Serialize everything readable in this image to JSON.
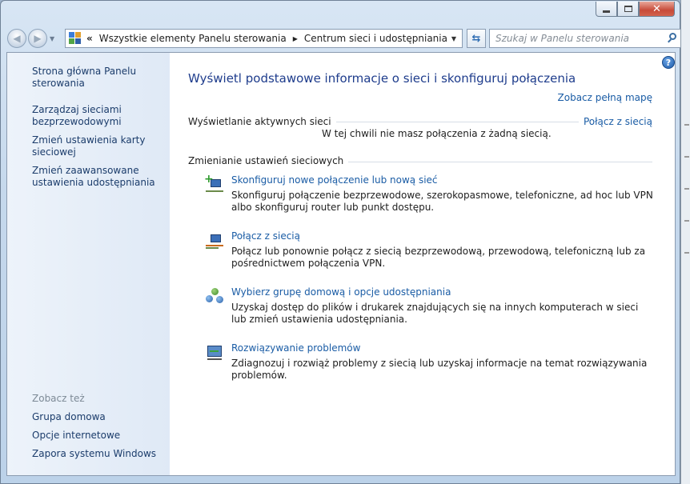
{
  "window": {
    "caption_minimize": "",
    "caption_maximize": "",
    "caption_close": "✕"
  },
  "nav": {
    "chevron": "«",
    "breadcrumbs": [
      "Wszystkie elementy Panelu sterowania",
      "Centrum sieci i udostępniania"
    ],
    "search_placeholder": "Szukaj w Panelu sterowania"
  },
  "sidebar": {
    "links": [
      "Strona główna Panelu sterowania",
      "Zarządzaj sieciami bezprzewodowymi",
      "Zmień ustawienia karty sieciowej",
      "Zmień zaawansowane ustawienia udostępniania"
    ],
    "see_also_heading": "Zobacz też",
    "see_also": [
      "Grupa domowa",
      "Opcje internetowe",
      "Zapora systemu Windows"
    ]
  },
  "main": {
    "title": "Wyświetl podstawowe informacje o sieci i skonfiguruj połączenia",
    "full_map_link": "Zobacz pełną mapę",
    "active_networks_label": "Wyświetlanie aktywnych sieci",
    "connect_link": "Połącz z siecią",
    "no_connection_text": "W tej chwili nie masz połączenia z żadną siecią.",
    "change_settings_label": "Zmienianie ustawień sieciowych",
    "tasks": [
      {
        "icon": "new-connection-icon",
        "title": "Skonfiguruj nowe połączenie lub nową sieć",
        "description": "Skonfiguruj połączenie bezprzewodowe, szerokopasmowe, telefoniczne, ad hoc lub VPN albo skonfiguruj router lub punkt dostępu."
      },
      {
        "icon": "connect-network-icon",
        "title": "Połącz z siecią",
        "description": "Połącz lub ponownie połącz z siecią bezprzewodową, przewodową, telefoniczną lub za pośrednictwem połączenia VPN."
      },
      {
        "icon": "homegroup-icon",
        "title": "Wybierz grupę domową i opcje udostępniania",
        "description": "Uzyskaj dostęp do plików i drukarek znajdujących się na innych komputerach w sieci lub zmień ustawienia udostępniania."
      },
      {
        "icon": "troubleshoot-icon",
        "title": "Rozwiązywanie problemów",
        "description": "Zdiagnozuj i rozwiąż problemy z siecią lub uzyskaj informacje na temat rozwiązywania problemów."
      }
    ],
    "help_glyph": "?"
  },
  "colors": {
    "link": "#1a5ca5",
    "title": "#1e3c8c",
    "sidebar_bg": "#e5eef8",
    "close_button": "#c74b39"
  }
}
